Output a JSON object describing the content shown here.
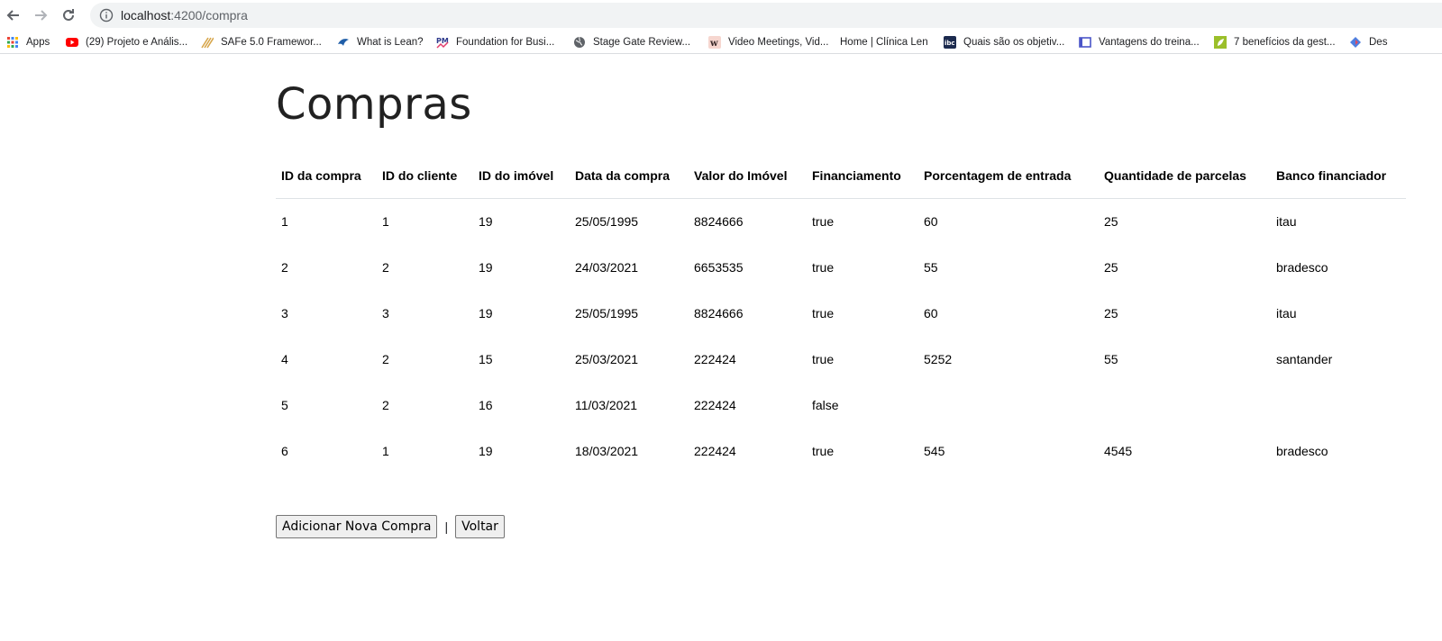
{
  "browser": {
    "url_host": "localhost",
    "url_path": ":4200/compra",
    "bookmarks": [
      {
        "label": "Apps",
        "icon": "apps-grid-icon",
        "color": "#4285f4"
      },
      {
        "label": "(29) Projeto e Anális...",
        "icon": "youtube-icon",
        "color": "#ff0000"
      },
      {
        "label": "SAFe 5.0 Framewor...",
        "icon": "safe-stripes-icon",
        "color": "#d7a64b"
      },
      {
        "label": "What is Lean?",
        "icon": "lean-bird-icon",
        "color": "#1f5ea8"
      },
      {
        "label": "Foundation for Busi...",
        "icon": "pm-logo-icon",
        "color": "#2e3a8c"
      },
      {
        "label": "Stage Gate Review...",
        "icon": "globe-icon",
        "color": "#5f6368"
      },
      {
        "label": "Video Meetings, Vid...",
        "icon": "whereby-icon",
        "color": "#e8a89a"
      },
      {
        "label": "Home | Clínica Len",
        "icon": "",
        "color": ""
      },
      {
        "label": "Quais são os objetiv...",
        "icon": "ibc-icon",
        "color": "#1b2a4e"
      },
      {
        "label": "Vantagens do treina...",
        "icon": "frame-icon",
        "color": "#4a55c8"
      },
      {
        "label": "7 benefícios da gest...",
        "icon": "leaf-icon",
        "color": "#9bbf2a"
      },
      {
        "label": "Des",
        "icon": "diamond-icon",
        "color": "#4e7fe0"
      }
    ]
  },
  "page": {
    "title": "Compras",
    "table": {
      "headers": [
        "ID da compra",
        "ID do cliente",
        "ID do imóvel",
        "Data da compra",
        "Valor do Imóvel",
        "Financiamento",
        "Porcentagem de entrada",
        "Quantidade de parcelas",
        "Banco financiador"
      ],
      "rows": [
        [
          "1",
          "1",
          "19",
          "25/05/1995",
          "8824666",
          "true",
          "60",
          "25",
          "itau"
        ],
        [
          "2",
          "2",
          "19",
          "24/03/2021",
          "6653535",
          "true",
          "55",
          "25",
          "bradesco"
        ],
        [
          "3",
          "3",
          "19",
          "25/05/1995",
          "8824666",
          "true",
          "60",
          "25",
          "itau"
        ],
        [
          "4",
          "2",
          "15",
          "25/03/2021",
          "222424",
          "true",
          "5252",
          "55",
          "santander"
        ],
        [
          "5",
          "2",
          "16",
          "11/03/2021",
          "222424",
          "false",
          "",
          "",
          ""
        ],
        [
          "6",
          "1",
          "19",
          "18/03/2021",
          "222424",
          "true",
          "545",
          "4545",
          "bradesco"
        ]
      ]
    },
    "actions": {
      "add_label": "Adicionar Nova Compra",
      "separator": "|",
      "back_label": "Voltar"
    }
  }
}
